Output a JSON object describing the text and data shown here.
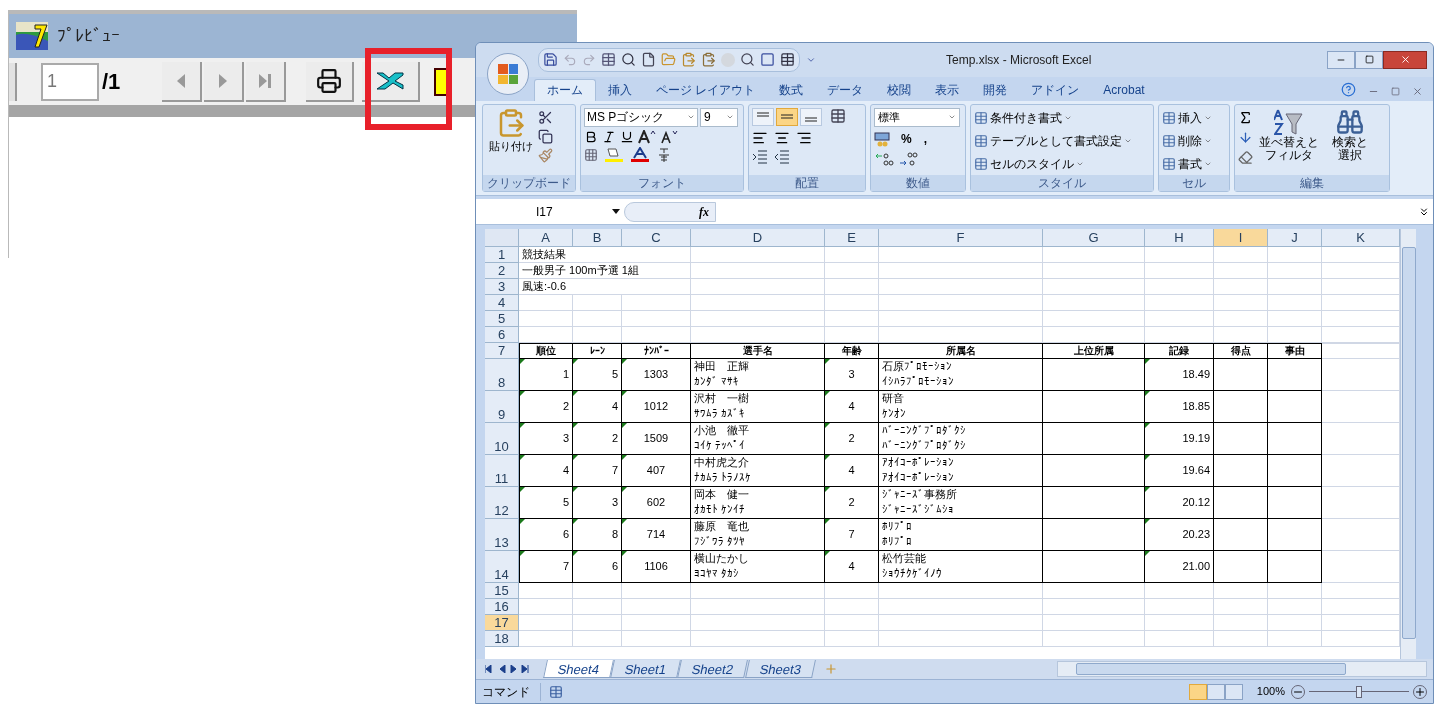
{
  "preview": {
    "title": "ﾌﾟﾚﾋﾞｭｰ",
    "page_field": {
      "value": "1"
    },
    "page_total": "/1"
  },
  "excel": {
    "title": "Temp.xlsx - Microsoft Excel",
    "tabs": [
      {
        "label": "ホーム",
        "selected": true
      },
      {
        "label": "挿入",
        "selected": false
      },
      {
        "label": "ページ レイアウト",
        "selected": false
      },
      {
        "label": "数式",
        "selected": false
      },
      {
        "label": "データ",
        "selected": false
      },
      {
        "label": "校閲",
        "selected": false
      },
      {
        "label": "表示",
        "selected": false
      },
      {
        "label": "開発",
        "selected": false
      },
      {
        "label": "アドイン",
        "selected": false
      },
      {
        "label": "Acrobat",
        "selected": false
      }
    ],
    "ribbon": [
      {
        "kind": "clipboard",
        "label": "クリップボード",
        "paste": "貼り付け"
      },
      {
        "kind": "font",
        "label": "フォント",
        "font_name": "MS Pゴシック",
        "font_size": "9"
      },
      {
        "kind": "alignment",
        "label": "配置",
        "vertical_buttons": [
          {
            "selected": false
          },
          {
            "selected": true
          },
          {
            "selected": false
          }
        ]
      },
      {
        "kind": "number",
        "label": "数値",
        "format": "標準",
        "percent": "%",
        "comma": ","
      },
      {
        "kind": "styles",
        "label": "スタイル",
        "commands": [
          "条件付き書式",
          "テーブルとして書式設定",
          "セルのスタイル"
        ]
      },
      {
        "kind": "cells",
        "label": "セル",
        "commands": [
          "挿入",
          "削除",
          "書式"
        ]
      },
      {
        "kind": "editing",
        "label": "編集",
        "sort": [
          "並べ替えと",
          "フィルタ"
        ],
        "find": [
          "検索と",
          "選択"
        ]
      }
    ],
    "name_box": "I17",
    "formula_label": "fx",
    "columns": [
      {
        "label": "A",
        "selected": false
      },
      {
        "label": "B",
        "selected": false
      },
      {
        "label": "C",
        "selected": false
      },
      {
        "label": "D",
        "selected": false
      },
      {
        "label": "E",
        "selected": false
      },
      {
        "label": "F",
        "selected": false
      },
      {
        "label": "G",
        "selected": false
      },
      {
        "label": "H",
        "selected": false
      },
      {
        "label": "I",
        "selected": true
      },
      {
        "label": "J",
        "selected": false
      },
      {
        "label": "K",
        "selected": false
      }
    ],
    "rows": [
      {
        "number": "1",
        "kind": "plain",
        "selected": false,
        "cells": [
          {
            "lines": [
              "競技結果"
            ],
            "flagged": false
          }
        ]
      },
      {
        "number": "2",
        "kind": "plain",
        "selected": false,
        "cells": [
          {
            "lines": [
              "一般男子 100m予選 1組"
            ],
            "flagged": false
          }
        ]
      },
      {
        "number": "3",
        "kind": "plain",
        "selected": false,
        "cells": [
          {
            "lines": [
              "風速:-0.6"
            ],
            "flagged": false
          }
        ]
      },
      {
        "number": "4",
        "kind": "plain",
        "selected": false
      },
      {
        "number": "5",
        "kind": "plain",
        "selected": false
      },
      {
        "number": "6",
        "kind": "plain",
        "selected": false
      },
      {
        "number": "7",
        "kind": "header",
        "selected": false,
        "cells": [
          {
            "lines": [
              "順位"
            ],
            "flagged": false
          },
          {
            "lines": [
              "ﾚｰﾝ"
            ],
            "flagged": false
          },
          {
            "lines": [
              "ﾅﾝﾊﾞｰ"
            ],
            "flagged": false
          },
          {
            "lines": [
              "選手名"
            ],
            "flagged": false
          },
          {
            "lines": [
              "年齢"
            ],
            "flagged": false
          },
          {
            "lines": [
              "所属名"
            ],
            "flagged": false
          },
          {
            "lines": [
              "上位所属"
            ],
            "flagged": false
          },
          {
            "lines": [
              "記録"
            ],
            "flagged": false
          },
          {
            "lines": [
              "得点"
            ],
            "flagged": false
          },
          {
            "lines": [
              "事由"
            ],
            "flagged": false
          }
        ]
      },
      {
        "number": "8",
        "kind": "entry",
        "selected": false,
        "cells": [
          {
            "lines": [
              "1"
            ],
            "flagged": true
          },
          {
            "lines": [
              "5"
            ],
            "flagged": true
          },
          {
            "lines": [
              "1303"
            ],
            "flagged": true
          },
          {
            "lines": [
              "神田　正輝",
              "ｶﾝﾀﾞ ﾏｻｷ"
            ],
            "flagged": false
          },
          {
            "lines": [
              "3"
            ],
            "flagged": true
          },
          {
            "lines": [
              "石原ﾌﾟﾛﾓｰｼｮﾝ",
              "ｲｼﾊﾗﾌﾟﾛﾓｰｼｮﾝ"
            ],
            "flagged": false
          },
          {},
          {
            "lines": [
              "18.49"
            ],
            "flagged": true
          }
        ]
      },
      {
        "number": "9",
        "kind": "entry",
        "selected": false,
        "cells": [
          {
            "lines": [
              "2"
            ],
            "flagged": true
          },
          {
            "lines": [
              "4"
            ],
            "flagged": true
          },
          {
            "lines": [
              "1012"
            ],
            "flagged": true
          },
          {
            "lines": [
              "沢村　一樹",
              "ｻﾜﾑﾗ ｶｽﾞｷ"
            ],
            "flagged": false
          },
          {
            "lines": [
              "4"
            ],
            "flagged": true
          },
          {
            "lines": [
              "研音",
              "ｹﾝｵﾝ"
            ],
            "flagged": false
          },
          {},
          {
            "lines": [
              "18.85"
            ],
            "flagged": true
          }
        ]
      },
      {
        "number": "10",
        "kind": "entry",
        "selected": false,
        "cells": [
          {
            "lines": [
              "3"
            ],
            "flagged": true
          },
          {
            "lines": [
              "2"
            ],
            "flagged": true
          },
          {
            "lines": [
              "1509"
            ],
            "flagged": true
          },
          {
            "lines": [
              "小池　徹平",
              "ｺｲｹ ﾃｯﾍﾟｲ"
            ],
            "flagged": false
          },
          {
            "lines": [
              "2"
            ],
            "flagged": true
          },
          {
            "lines": [
              "ﾊﾞｰﾆﾝｸﾞﾌﾟﾛﾀﾞｸｼ",
              "ﾊﾞｰﾆﾝｸﾞﾌﾟﾛﾀﾞｸｼ"
            ],
            "flagged": false
          },
          {},
          {
            "lines": [
              "19.19"
            ],
            "flagged": true
          }
        ]
      },
      {
        "number": "11",
        "kind": "entry",
        "selected": false,
        "cells": [
          {
            "lines": [
              "4"
            ],
            "flagged": true
          },
          {
            "lines": [
              "7"
            ],
            "flagged": true
          },
          {
            "lines": [
              "407"
            ],
            "flagged": true
          },
          {
            "lines": [
              "中村虎之介",
              "ﾅｶﾑﾗ ﾄﾗﾉｽｹ"
            ],
            "flagged": false
          },
          {
            "lines": [
              "4"
            ],
            "flagged": true
          },
          {
            "lines": [
              "ｱｵｲｺｰﾎﾟﾚｰｼｮﾝ",
              "ｱｵｲｺｰﾎﾟﾚｰｼｮﾝ"
            ],
            "flagged": false
          },
          {},
          {
            "lines": [
              "19.64"
            ],
            "flagged": true
          }
        ]
      },
      {
        "number": "12",
        "kind": "entry",
        "selected": false,
        "cells": [
          {
            "lines": [
              "5"
            ],
            "flagged": true
          },
          {
            "lines": [
              "3"
            ],
            "flagged": true
          },
          {
            "lines": [
              "602"
            ],
            "flagged": true
          },
          {
            "lines": [
              "岡本　健一",
              "ｵｶﾓﾄ ｹﾝｲﾁ"
            ],
            "flagged": false
          },
          {
            "lines": [
              "2"
            ],
            "flagged": true
          },
          {
            "lines": [
              "ｼﾞｬﾆｰｽﾞ事務所",
              "ｼﾞｬﾆｰｽﾞｼﾞﾑｼｮ"
            ],
            "flagged": false
          },
          {},
          {
            "lines": [
              "20.12"
            ],
            "flagged": true
          }
        ]
      },
      {
        "number": "13",
        "kind": "entry",
        "selected": false,
        "cells": [
          {
            "lines": [
              "6"
            ],
            "flagged": true
          },
          {
            "lines": [
              "8"
            ],
            "flagged": true
          },
          {
            "lines": [
              "714"
            ],
            "flagged": true
          },
          {
            "lines": [
              "藤原　竜也",
              "ﾌｼﾞﾜﾗ ﾀﾂﾔ"
            ],
            "flagged": false
          },
          {
            "lines": [
              "7"
            ],
            "flagged": true
          },
          {
            "lines": [
              "ﾎﾘﾌﾟﾛ",
              "ﾎﾘﾌﾟﾛ"
            ],
            "flagged": false
          },
          {},
          {
            "lines": [
              "20.23"
            ],
            "flagged": true
          }
        ]
      },
      {
        "number": "14",
        "kind": "entry",
        "selected": false,
        "cells": [
          {
            "lines": [
              "7"
            ],
            "flagged": true
          },
          {
            "lines": [
              "6"
            ],
            "flagged": true
          },
          {
            "lines": [
              "1106"
            ],
            "flagged": true
          },
          {
            "lines": [
              "横山たかし",
              "ﾖｺﾔﾏ ﾀｶｼ"
            ],
            "flagged": false
          },
          {
            "lines": [
              "4"
            ],
            "flagged": true
          },
          {
            "lines": [
              "松竹芸能",
              "ｼｮｳﾁｸｹﾞｲﾉｳ"
            ],
            "flagged": false
          },
          {},
          {
            "lines": [
              "21.00"
            ],
            "flagged": true
          }
        ]
      },
      {
        "number": "15",
        "kind": "plain",
        "selected": false
      },
      {
        "number": "16",
        "kind": "plain",
        "selected": false
      },
      {
        "number": "17",
        "kind": "plain",
        "selected": true
      },
      {
        "number": "18",
        "kind": "plain",
        "selected": false
      }
    ],
    "sheet_tabs": [
      {
        "label": "Sheet4",
        "selected": true
      },
      {
        "label": "Sheet1",
        "selected": false
      },
      {
        "label": "Sheet2",
        "selected": false
      },
      {
        "label": "Sheet3",
        "selected": false
      }
    ],
    "status": {
      "mode": "コマンド",
      "views": [
        {
          "selected": true
        },
        {
          "selected": false
        },
        {
          "selected": false
        }
      ],
      "zoom": {
        "reading": "100%",
        "level": 0.5
      }
    }
  }
}
